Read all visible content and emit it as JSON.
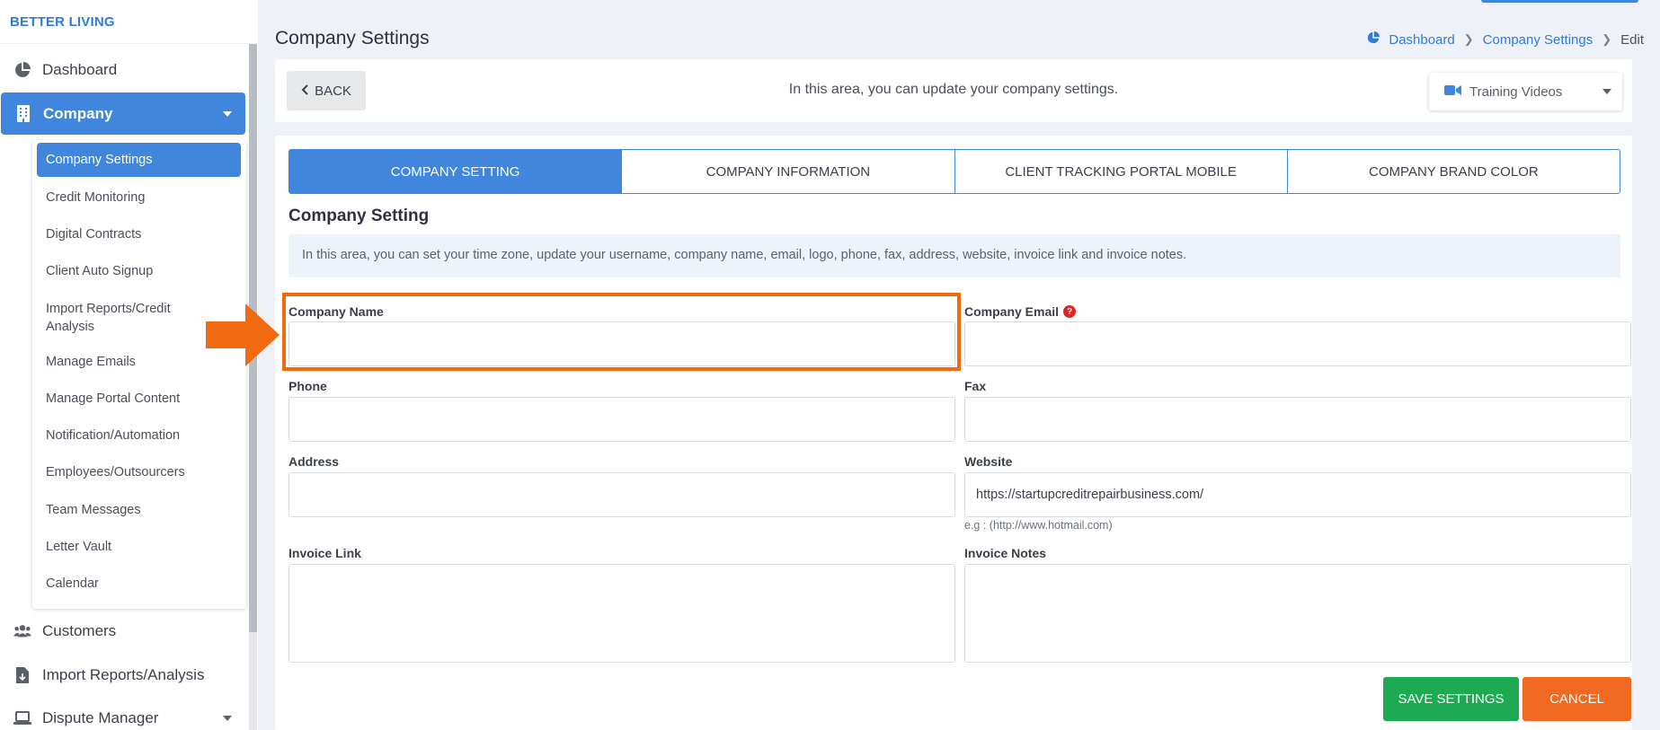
{
  "brand": "BETTER LIVING",
  "sidebar": {
    "items": [
      {
        "label": "Dashboard",
        "icon": "pie-chart-icon"
      },
      {
        "label": "Company",
        "icon": "building-icon"
      },
      {
        "label": "Customers",
        "icon": "users-icon"
      },
      {
        "label": "Import Reports/Analysis",
        "icon": "file-import-icon"
      },
      {
        "label": "Dispute Manager",
        "icon": "laptop-icon"
      }
    ],
    "submenu": [
      "Company Settings",
      "Credit Monitoring",
      "Digital Contracts",
      "Client Auto Signup",
      "Import Reports/Credit Analysis",
      "Manage Emails",
      "Manage Portal Content",
      "Notification/Automation",
      "Employees/Outsourcers",
      "Team Messages",
      "Letter Vault",
      "Calendar"
    ]
  },
  "header": {
    "title": "Company Settings",
    "breadcrumb": [
      "Dashboard",
      "Company Settings",
      "Edit"
    ]
  },
  "topbar": {
    "back_label": "BACK",
    "description": "In this area, you can update your company settings.",
    "training_label": "Training Videos"
  },
  "tabs": [
    "COMPANY SETTING",
    "COMPANY INFORMATION",
    "CLIENT TRACKING PORTAL MOBILE",
    "COMPANY BRAND COLOR"
  ],
  "section": {
    "title": "Company Setting",
    "info": "In this area, you can set your time zone, update your username, company name, email, logo, phone, fax, address, website, invoice link and invoice notes."
  },
  "form": {
    "company_name": {
      "label": "Company Name",
      "value": ""
    },
    "company_email": {
      "label": "Company Email",
      "value": ""
    },
    "phone": {
      "label": "Phone",
      "value": ""
    },
    "fax": {
      "label": "Fax",
      "value": ""
    },
    "address": {
      "label": "Address",
      "value": ""
    },
    "website": {
      "label": "Website",
      "value": "https://startupcreditrepairbusiness.com/",
      "hint": "e.g : (http://www.hotmail.com)"
    },
    "invoice_link": {
      "label": "Invoice Link",
      "value": ""
    },
    "invoice_notes": {
      "label": "Invoice Notes",
      "value": ""
    }
  },
  "actions": {
    "save_label": "SAVE SETTINGS",
    "cancel_label": "CANCEL"
  },
  "colors": {
    "accent": "#3f86dc",
    "save": "#1eaa52",
    "cancel": "#f26a22",
    "highlight": "#f26a0f"
  }
}
